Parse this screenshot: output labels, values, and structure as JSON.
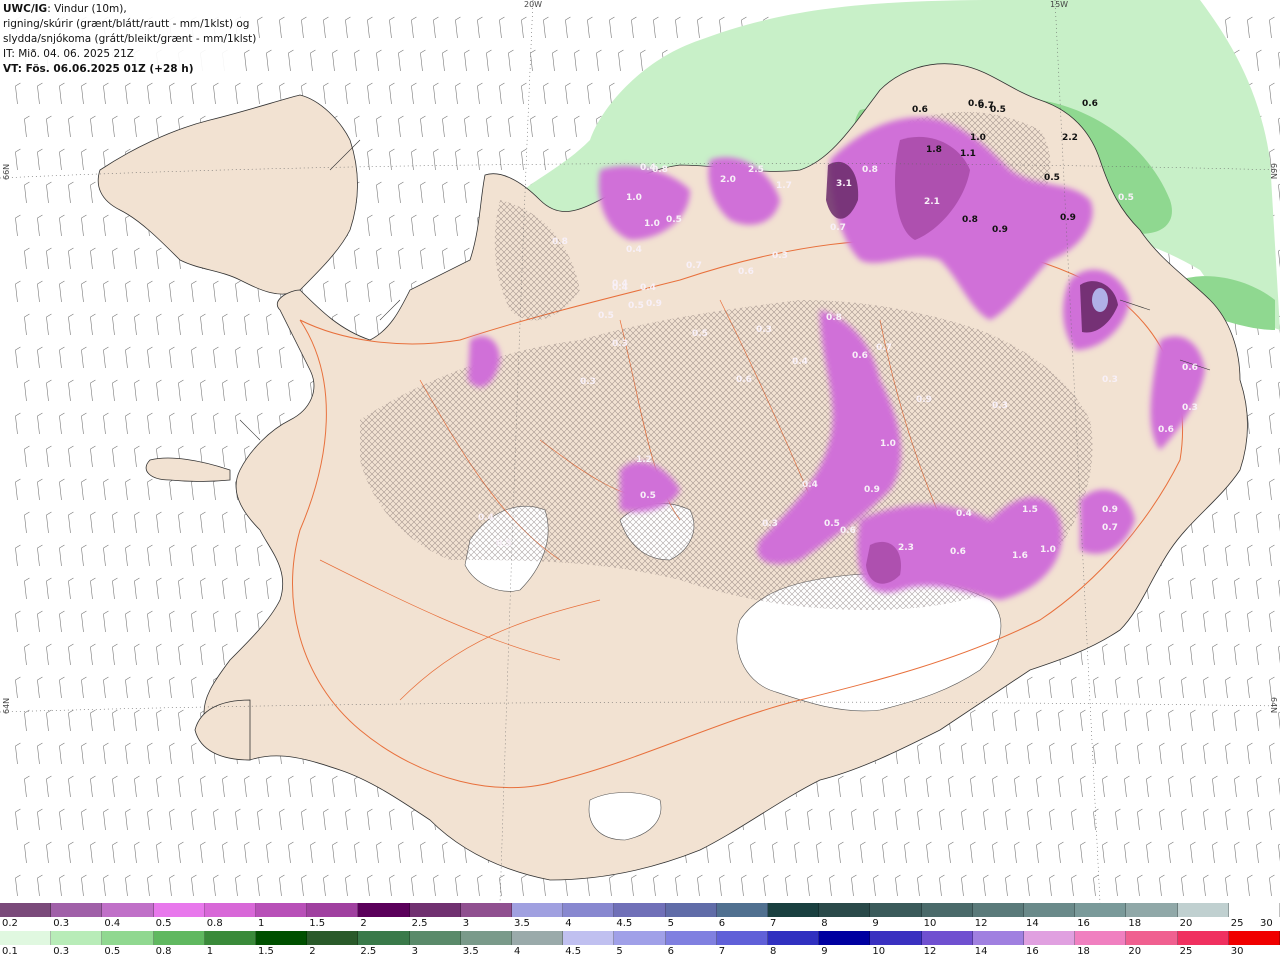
{
  "header": {
    "model": "UWC/IG",
    "line1_rest": ": Vindur (10m),",
    "line2": "rigning/skúrir (grænt/blátt/rautt - mm/1klst) og",
    "line3": "slydda/snjókoma (grátt/bleikt/grænt - mm/1klst)",
    "line4": "IT: Mið. 04. 06. 2025 21Z",
    "line5": "VT: Fös. 06.06.2025 01Z (+28 h)"
  },
  "grid": {
    "lon_labels": [
      "20W",
      "15W"
    ],
    "lat_labels": [
      "66N",
      "64N"
    ]
  },
  "colors": {
    "land": "#f2e2d2",
    "glacier": "#ffffff",
    "roads": "#e8703c",
    "rain_light": "#c8f0c8",
    "rain_medium": "#8fd890",
    "rain_heavy": "#4aa85a",
    "snow_light": "#d070d8",
    "snow_medium": "#a84aa8",
    "snow_heavy": "#6a2a6a"
  },
  "map_values": {
    "labels": [
      "0.6",
      "0.6",
      "0.5",
      "0.7",
      "1.0",
      "1.8",
      "1.1",
      "2.2",
      "0.5",
      "0.6",
      "0.9",
      "0.8",
      "2.1",
      "0.9",
      "3.1",
      "0.8",
      "0.5",
      "0.7",
      "2.0",
      "2.5",
      "1.7",
      "0.4",
      "0.8",
      "1.0",
      "1.0",
      "0.5",
      "0.4",
      "0.7",
      "0.4",
      "0.4",
      "0.5",
      "0.9",
      "0.8",
      "0.5",
      "0.3",
      "0.4",
      "0.6",
      "0.3",
      "0.5",
      "0.3",
      "0.3",
      "0.6",
      "0.4",
      "0.7",
      "0.6",
      "0.9",
      "0.3",
      "0.3",
      "0.6",
      "1.0",
      "0.8",
      "0.4",
      "0.9",
      "0.6",
      "0.3",
      "0.4",
      "1.5",
      "2.3",
      "0.6",
      "1.6",
      "1.0",
      "0.9",
      "0.7",
      "1.2",
      "0.5",
      "0.4",
      "0.5",
      "0.3",
      "0.5",
      "0.6"
    ]
  },
  "legend": {
    "snow_colors": [
      "#7a4a7a",
      "#a060a8",
      "#c070c8",
      "#e878ec",
      "#d868d8",
      "#b850b8",
      "#a040a0",
      "#5a005a",
      "#703070",
      "#905090",
      "#a0a0e0",
      "#8888d0",
      "#7070b8",
      "#606ca8",
      "#507090",
      "#1a4040",
      "#2a4a4a",
      "#3a5a5a",
      "#4a6a6a",
      "#5a7a7a",
      "#6a8a8a",
      "#7a9a9a",
      "#90a8a8",
      "#c0d0d0",
      "#ffffff"
    ],
    "snow_labels": [
      "0.2",
      "0.3",
      "0.4",
      "0.5",
      "0.8",
      "1",
      "1.5",
      "2",
      "2.5",
      "3",
      "3.5",
      "4",
      "4.5",
      "5",
      "6",
      "7",
      "8",
      "9",
      "10",
      "12",
      "14",
      "16",
      "18",
      "20",
      "25",
      "30"
    ],
    "rain_colors": [
      "#e0f8e0",
      "#b8ecb8",
      "#90d890",
      "#60b860",
      "#3a8a3a",
      "#005000",
      "#2a5a2a",
      "#3a7a4a",
      "#5a8a6a",
      "#7a9a8a",
      "#9aaaaa",
      "#c0c0f0",
      "#a0a0e8",
      "#8080e0",
      "#6060d8",
      "#3030c0",
      "#0000a0",
      "#3a30c0",
      "#7050d0",
      "#a080e0",
      "#e0a0e0",
      "#f080c0",
      "#f06090",
      "#f03060",
      "#f00000"
    ],
    "rain_labels": [
      "0.1",
      "0.3",
      "0.5",
      "0.8",
      "1",
      "1.5",
      "2",
      "2.5",
      "3",
      "3.5",
      "4",
      "4.5",
      "5",
      "6",
      "7",
      "8",
      "9",
      "10",
      "12",
      "14",
      "16",
      "18",
      "20",
      "25",
      "30"
    ]
  }
}
